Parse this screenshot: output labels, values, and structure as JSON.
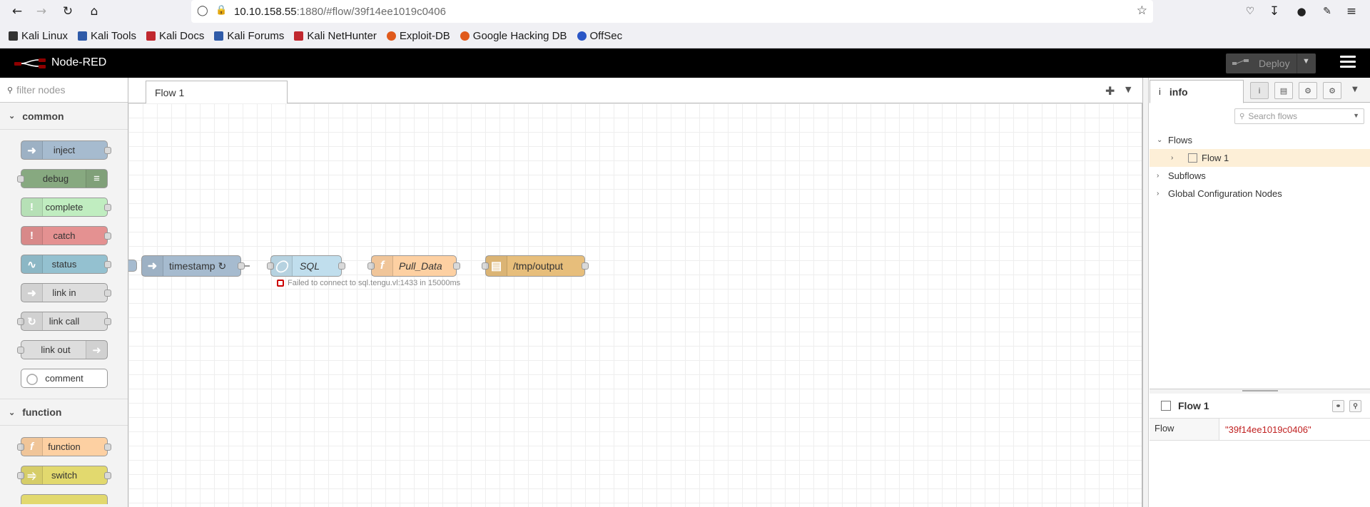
{
  "browser": {
    "url_host": "10.10.158.55",
    "url_rest": ":1880/#flow/39f14ee1019c0406",
    "bookmarks": [
      "Kali Linux",
      "Kali Tools",
      "Kali Docs",
      "Kali Forums",
      "Kali NetHunter",
      "Exploit-DB",
      "Google Hacking DB",
      "OffSec"
    ]
  },
  "header": {
    "title": "Node-RED",
    "deploy_label": "Deploy"
  },
  "palette": {
    "filter_placeholder": "filter nodes",
    "categories": [
      "common",
      "function"
    ],
    "common_nodes": [
      "inject",
      "debug",
      "complete",
      "catch",
      "status",
      "link in",
      "link call",
      "link out",
      "comment"
    ],
    "function_nodes": [
      "function",
      "switch"
    ]
  },
  "workspace": {
    "tab_label": "Flow 1",
    "nodes": {
      "timestamp": "timestamp ↻",
      "sql": "SQL",
      "pull": "Pull_Data",
      "output": "/tmp/output"
    },
    "status_text": "Failed to connect to sql.tengu.vl:1433 in 15000ms"
  },
  "sidebar": {
    "tab_label": "info",
    "search_placeholder": "Search flows",
    "tree": {
      "flows": "Flows",
      "flow1": "Flow 1",
      "subflows": "Subflows",
      "global": "Global Configuration Nodes"
    },
    "props": {
      "title": "Flow 1",
      "key": "Flow",
      "value": "\"39f14ee1019c0406\""
    }
  },
  "colors": {
    "inject": "#a6bbcf",
    "debug": "#87a980",
    "complete": "#c0edc0",
    "catch": "#e49191",
    "status": "#94c1d0",
    "link": "#dddddd",
    "comment": "#ffffff",
    "function": "#fdd0a2",
    "switch": "#e2d96e",
    "sql": "#c0deed",
    "file": "#e7be7b"
  }
}
